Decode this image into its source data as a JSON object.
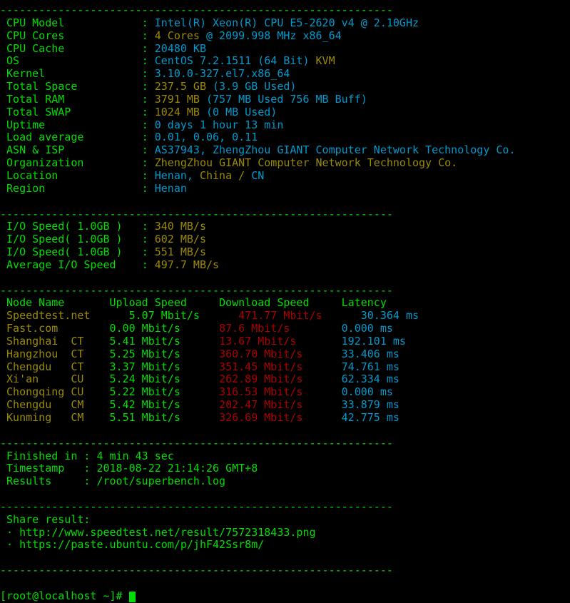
{
  "terminal": {
    "background_color": "#000000",
    "colors": {
      "green": "#00dd00",
      "cyan": "#0099cc",
      "yellow": "#9a8a00",
      "red": "#aa0000"
    },
    "separator": "-------------------------------------------------------------",
    "prompt": "[root@localhost ~]#"
  },
  "sysinfo": {
    "rows": [
      {
        "label": "CPU Model",
        "sep": ":",
        "value_cyan": "Intel(R) Xeon(R) CPU E5-2620 v4 @ 2.10GHz",
        "value_yellow": ""
      },
      {
        "label": "CPU Cores",
        "sep": ":",
        "value_yellow": "4 Cores",
        "value_cyan": "@ 2099.998 MHz x86_64"
      },
      {
        "label": "CPU Cache",
        "sep": ":",
        "value_cyan": "20480 KB",
        "value_yellow": ""
      },
      {
        "label": "OS",
        "sep": ":",
        "value_cyan": "CentOS 7.2.1511 (64 Bit)",
        "value_yellow": "KVM"
      },
      {
        "label": "Kernel",
        "sep": ":",
        "value_cyan": "3.10.0-327.el7.x86_64",
        "value_yellow": ""
      },
      {
        "label": "Total Space",
        "sep": ":",
        "value_yellow": "237.5 GB",
        "value_cyan": "(3.9 GB Used)"
      },
      {
        "label": "Total RAM",
        "sep": ":",
        "value_yellow": "3791 MB",
        "value_cyan": "(757 MB Used 756 MB Buff)"
      },
      {
        "label": "Total SWAP",
        "sep": ":",
        "value_yellow": "1024 MB",
        "value_cyan": "(0 MB Used)"
      },
      {
        "label": "Uptime",
        "sep": ":",
        "value_cyan": "0 days 1 hour 13 min",
        "value_yellow": ""
      },
      {
        "label": "Load average",
        "sep": ":",
        "value_cyan": "0.01, 0.06, 0.11",
        "value_yellow": ""
      },
      {
        "label": "ASN & ISP",
        "sep": ":",
        "value_cyan": "AS37943, ZhengZhou GIANT Computer Network Technology Co.",
        "value_yellow": ""
      },
      {
        "label": "Organization",
        "sep": ":",
        "value_cyan": "",
        "value_yellow": "ZhengZhou GIANT Computer Network Technology Co."
      },
      {
        "label": "Location",
        "sep": ":",
        "value_cyan": "Henan,",
        "value_yellow": "China / ",
        "value_cyan2": "CN"
      },
      {
        "label": "Region",
        "sep": ":",
        "value_cyan": "Henan",
        "value_yellow": ""
      }
    ]
  },
  "io": {
    "rows": [
      {
        "label": "I/O Speed( 1.0GB )",
        "sep": ":",
        "value": "340 MB/s"
      },
      {
        "label": "I/O Speed( 1.0GB )",
        "sep": ":",
        "value": "602 MB/s"
      },
      {
        "label": "I/O Speed( 1.0GB )",
        "sep": ":",
        "value": "551 MB/s"
      },
      {
        "label": "Average I/O Speed",
        "sep": ":",
        "value": "497.7 MB/s"
      }
    ]
  },
  "speedtest": {
    "headers": {
      "node": "Node Name",
      "upload": "Upload Speed",
      "download": "Download Speed",
      "latency": "Latency"
    },
    "rows": [
      {
        "node": "Speedtest.net",
        "carrier": "",
        "upload": "5.07 Mbit/s",
        "download": "471.77 Mbit/s",
        "latency": "30.364 ms"
      },
      {
        "node": "Fast.com",
        "carrier": "",
        "upload": "0.00 Mbit/s",
        "download": "87.6 Mbit/s",
        "latency": "0.000 ms"
      },
      {
        "node": "Shanghai",
        "carrier": "CT",
        "upload": "5.41 Mbit/s",
        "download": "13.67 Mbit/s",
        "latency": "192.101 ms"
      },
      {
        "node": "Hangzhou",
        "carrier": "CT",
        "upload": "5.25 Mbit/s",
        "download": "360.70 Mbit/s",
        "latency": "33.406 ms"
      },
      {
        "node": "Chengdu",
        "carrier": "CT",
        "upload": "3.37 Mbit/s",
        "download": "351.45 Mbit/s",
        "latency": "74.761 ms"
      },
      {
        "node": "Xi'an",
        "carrier": "CU",
        "upload": "5.24 Mbit/s",
        "download": "262.89 Mbit/s",
        "latency": "62.334 ms"
      },
      {
        "node": "Chongqing",
        "carrier": "CU",
        "upload": "5.22 Mbit/s",
        "download": "316.53 Mbit/s",
        "latency": "0.000 ms"
      },
      {
        "node": "Chengdu",
        "carrier": "CM",
        "upload": "5.42 Mbit/s",
        "download": "202.47 Mbit/s",
        "latency": "33.879 ms"
      },
      {
        "node": "Kunming",
        "carrier": "CM",
        "upload": "5.51 Mbit/s",
        "download": "326.69 Mbit/s",
        "latency": "42.775 ms"
      }
    ]
  },
  "summary": {
    "rows": [
      {
        "label": "Finished in",
        "sep": ":",
        "value": "4 min 43 sec"
      },
      {
        "label": "Timestamp",
        "sep": ":",
        "value": "2018-08-22 21:14:26 GMT+8"
      },
      {
        "label": "Results",
        "sep": ":",
        "value": "/root/superbench.log"
      }
    ]
  },
  "share": {
    "title": "Share result:",
    "bullet": "·",
    "links": [
      "http://www.speedtest.net/result/7572318433.png",
      "https://paste.ubuntu.com/p/jhF42Ssr8m/"
    ]
  }
}
